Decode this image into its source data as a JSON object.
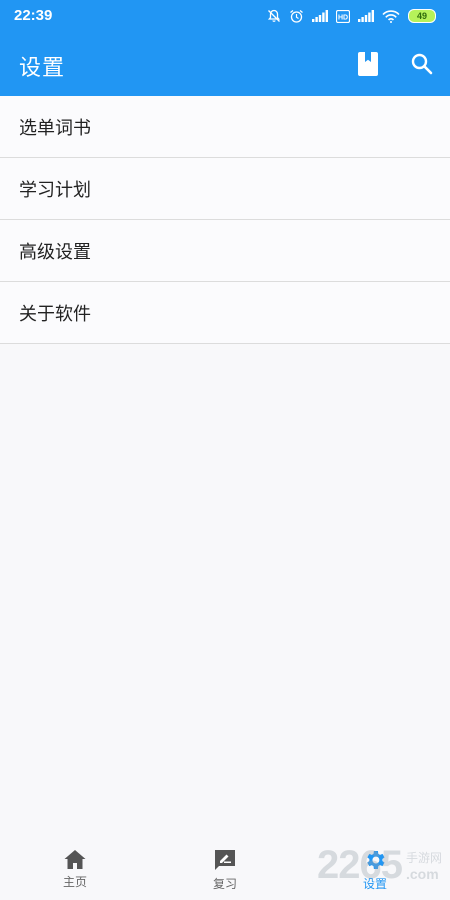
{
  "status_bar": {
    "time": "22:39",
    "battery": "49",
    "icons": [
      "bell-off-icon",
      "alarm-icon",
      "signal-icon",
      "hd-icon",
      "signal-icon",
      "wifi-icon",
      "battery-icon"
    ]
  },
  "app_bar": {
    "title": "设置",
    "color": "#2196f3",
    "actions": [
      "bookmark-book-icon",
      "search-icon"
    ]
  },
  "settings_list": {
    "items": [
      {
        "label": "选单词书"
      },
      {
        "label": "学习计划"
      },
      {
        "label": "高级设置"
      },
      {
        "label": "关于软件"
      }
    ]
  },
  "bottom_nav": {
    "items": [
      {
        "label": "主页",
        "icon": "home-icon"
      },
      {
        "label": "复习",
        "icon": "review-icon"
      },
      {
        "label": "设置",
        "icon": "gear-icon",
        "active": true
      }
    ]
  },
  "watermark": {
    "number": "2265",
    "line1": "手游网",
    "line2": ".com"
  }
}
